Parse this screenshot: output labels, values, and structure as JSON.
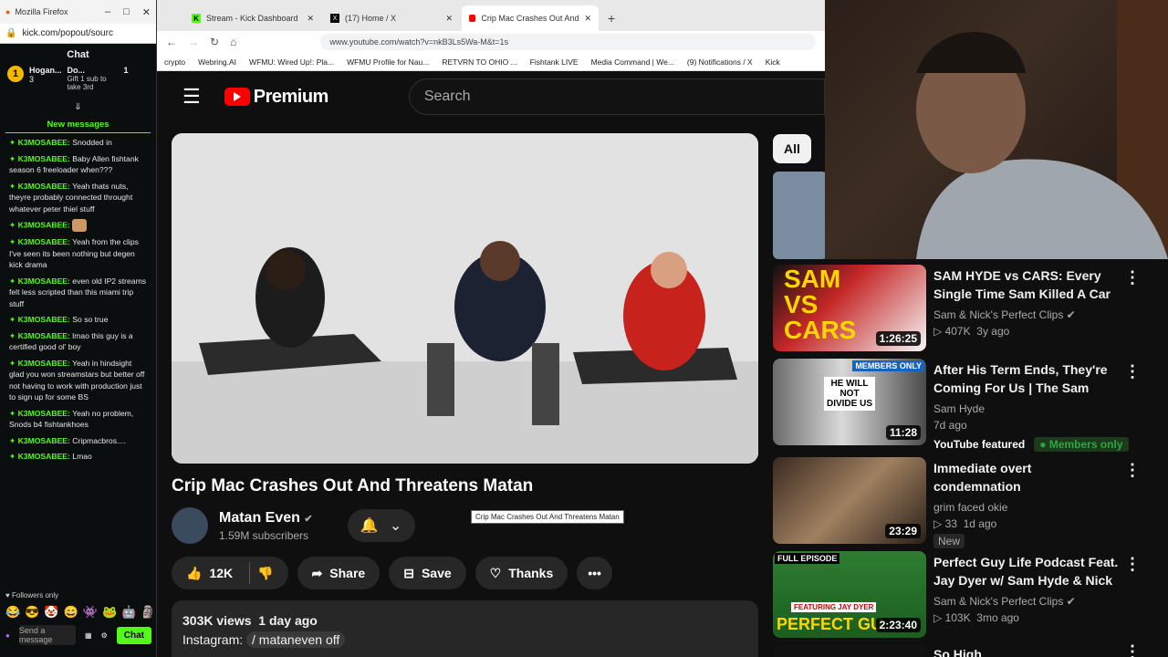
{
  "chat_window": {
    "title": "Mozilla Firefox",
    "url": "kick.com/popout/sourc",
    "heading": "Chat",
    "pinned": {
      "rank": "1",
      "user1": "Hogan...",
      "count1": "3",
      "user2": "Do...",
      "count2": "1",
      "gift_text": "Gift 1 sub to take 3rd"
    },
    "new_messages": "New messages",
    "messages": [
      {
        "user": "K3MOSABEE:",
        "text": "Snodded in"
      },
      {
        "user": "K3MOSABEE:",
        "text": "Baby Allen fishtank season 6 freeloader when???"
      },
      {
        "user": "K3MOSABEE:",
        "text": "Yeah thats nuts, theyre probably connected throught whatever peter thiel stuff"
      },
      {
        "user": "K3MOSABEE:",
        "text": ""
      },
      {
        "user": "K3MOSABEE:",
        "text": "Yeah from the clips I've seen its been nothing but degen kick drama"
      },
      {
        "user": "K3MOSABEE:",
        "text": "even old IP2 streams felt less scripted than this miami trip stuff"
      },
      {
        "user": "K3MOSABEE:",
        "text": "So so true"
      },
      {
        "user": "K3MOSABEE:",
        "text": "lmao this guy is a certified good ol' boy"
      },
      {
        "user": "K3MOSABEE:",
        "text": "Yeah in hindsight glad you won streamstars but better off not having to work with production just to sign up for some BS"
      },
      {
        "user": "K3MOSABEE:",
        "text": "Yeah no problem, Snods b4 fishtankhoes"
      },
      {
        "user": "K3MOSABEE:",
        "text": "Cripmacbros...."
      },
      {
        "user": "K3MOSABEE:",
        "text": "Lmao"
      }
    ],
    "followers_only": "Followers only",
    "send_placeholder": "Send a message",
    "chat_button": "Chat"
  },
  "browser": {
    "tabs": [
      {
        "label": "Stream - Kick Dashboard"
      },
      {
        "label": "(17) Home / X"
      },
      {
        "label": "Crip Mac Crashes Out And"
      }
    ],
    "url": "www.youtube.com/watch?v=nkB3Ls5Wa-M&t=1s",
    "bookmarks": [
      "crypto",
      "Webring.AI",
      "WFMU: Wired Up!: Pla...",
      "WFMU Profile for Nau...",
      "RETVRN TO OHIO ...",
      "Fishtank LIVE",
      "Media Command | We...",
      "(9) Notifications / X",
      "Kick"
    ]
  },
  "youtube": {
    "logo": "Premium",
    "search_placeholder": "Search",
    "video_title": "Crip Mac Crashes Out And Threatens Matan",
    "tooltip": "Crip Mac Crashes Out And Threatens Matan",
    "channel": "Matan Even",
    "subscribers": "1.59M subscribers",
    "likes": "12K",
    "share": "Share",
    "save": "Save",
    "thanks": "Thanks",
    "views": "303K views",
    "posted": "1 day ago",
    "instagram_label": "Instagram:",
    "instagram_handle": "/ mataneven off",
    "chip_all": "All"
  },
  "recommendations": [
    {
      "title": "SAM HYDE vs CARS: Every Single Time Sam Killed A Car ...",
      "channel": "Sam & Nick's Perfect Clips",
      "views": "407K",
      "age": "3y ago",
      "duration": "1:26:25"
    },
    {
      "title": "After His Term Ends, They're Coming For Us | The Sam Hyd...",
      "channel": "Sam Hyde",
      "age": "7d ago",
      "duration": "11:28",
      "featured": "YouTube featured",
      "members": "Members only",
      "thumb_badge": "MEMBERS ONLY",
      "thumb_text": "HE WILL NOT DIVIDE US"
    },
    {
      "title": "Immediate overt condemnation",
      "channel": "grim faced okie",
      "views": "33",
      "age": "1d ago",
      "duration": "23:29",
      "badge": "New"
    },
    {
      "title": "Perfect Guy Life Podcast Feat. Jay Dyer w/ Sam Hyde & Nick ...",
      "channel": "Sam & Nick's Perfect Clips",
      "views": "103K",
      "age": "3mo ago",
      "duration": "2:23:40",
      "thumb_badge": "FULL EPISODE",
      "thumb_text": "FEATURING JAY DYER",
      "thumb_text2": "PERFECT GU"
    },
    {
      "title": "So High"
    }
  ]
}
